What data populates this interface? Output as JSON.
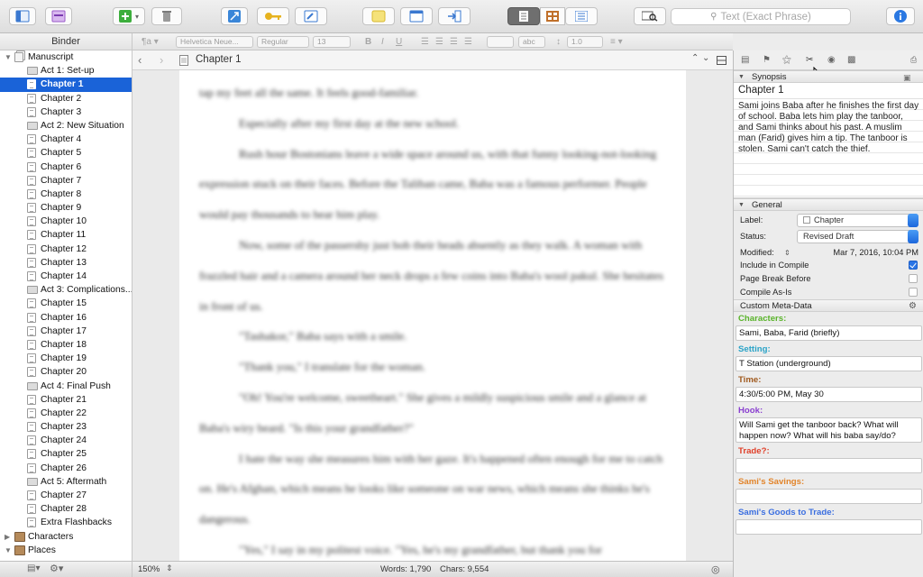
{
  "toolbar": {
    "search_placeholder": "Text (Exact Phrase)",
    "icons": [
      "binder-toggle-icon",
      "collections-icon",
      "add-icon",
      "trash-icon",
      "fullscreen-icon",
      "keywords-icon",
      "edit-scrivening-icon",
      "notes-icon",
      "layout-icon",
      "compile-icon",
      "editor-view-icon",
      "corkboard-icon",
      "outliner-icon",
      "quick-search-icon",
      "inspector-toggle-icon"
    ]
  },
  "binder": {
    "header": "Binder",
    "items": [
      {
        "label": "Manuscript",
        "level": 0,
        "type": "stack",
        "expanded": true
      },
      {
        "label": "Act 1: Set-up",
        "level": 1,
        "type": "folder"
      },
      {
        "label": "Chapter 1",
        "level": 1,
        "type": "doc",
        "selected": true
      },
      {
        "label": "Chapter 2",
        "level": 1,
        "type": "doc"
      },
      {
        "label": "Chapter 3",
        "level": 1,
        "type": "doc"
      },
      {
        "label": "Act 2: New Situation",
        "level": 1,
        "type": "folder"
      },
      {
        "label": "Chapter 4",
        "level": 1,
        "type": "doc"
      },
      {
        "label": "Chapter 5",
        "level": 1,
        "type": "doc"
      },
      {
        "label": "Chapter 6",
        "level": 1,
        "type": "doc"
      },
      {
        "label": "Chapter 7",
        "level": 1,
        "type": "doc"
      },
      {
        "label": "Chapter 8",
        "level": 1,
        "type": "doc"
      },
      {
        "label": "Chapter 9",
        "level": 1,
        "type": "doc"
      },
      {
        "label": "Chapter 10",
        "level": 1,
        "type": "doc"
      },
      {
        "label": "Chapter 11",
        "level": 1,
        "type": "doc"
      },
      {
        "label": "Chapter 12",
        "level": 1,
        "type": "doc"
      },
      {
        "label": "Chapter 13",
        "level": 1,
        "type": "doc"
      },
      {
        "label": "Chapter 14",
        "level": 1,
        "type": "doc"
      },
      {
        "label": "Act 3: Complications...",
        "level": 1,
        "type": "folder"
      },
      {
        "label": "Chapter 15",
        "level": 1,
        "type": "doc"
      },
      {
        "label": "Chapter 16",
        "level": 1,
        "type": "doc"
      },
      {
        "label": "Chapter 17",
        "level": 1,
        "type": "doc"
      },
      {
        "label": "Chapter 18",
        "level": 1,
        "type": "doc"
      },
      {
        "label": "Chapter 19",
        "level": 1,
        "type": "doc"
      },
      {
        "label": "Chapter 20",
        "level": 1,
        "type": "doc"
      },
      {
        "label": "Act 4: Final Push",
        "level": 1,
        "type": "folder"
      },
      {
        "label": "Chapter 21",
        "level": 1,
        "type": "doc"
      },
      {
        "label": "Chapter 22",
        "level": 1,
        "type": "doc"
      },
      {
        "label": "Chapter 23",
        "level": 1,
        "type": "doc"
      },
      {
        "label": "Chapter 24",
        "level": 1,
        "type": "doc"
      },
      {
        "label": "Chapter 25",
        "level": 1,
        "type": "doc"
      },
      {
        "label": "Chapter 26",
        "level": 1,
        "type": "doc"
      },
      {
        "label": "Act 5: Aftermath",
        "level": 1,
        "type": "folder"
      },
      {
        "label": "Chapter 27",
        "level": 1,
        "type": "doc"
      },
      {
        "label": "Chapter 28",
        "level": 1,
        "type": "doc"
      },
      {
        "label": "Extra Flashbacks",
        "level": 1,
        "type": "doc"
      },
      {
        "label": "Characters",
        "level": 0,
        "type": "pic",
        "expanded": false
      },
      {
        "label": "Places",
        "level": 0,
        "type": "pic",
        "expanded": true
      }
    ]
  },
  "formatbar": {
    "font": "Helvetica Neue...",
    "style": "Regular",
    "size": "13",
    "text_color": "abc",
    "line_spacing": "1.0"
  },
  "editor": {
    "title": "Chapter 1",
    "paragraphs": [
      {
        "text": "tap my feet all the same. It feels good-familiar.",
        "indent": false
      },
      {
        "text": "Especially after my first day at the new school.",
        "indent": true
      },
      {
        "text": "Rush hour Bostonians leave a wide space around us, with that funny looking-not-looking expression stuck on their faces. Before the Taliban came, Baba was a famous performer. People would pay thousands to hear him play.",
        "indent": true
      },
      {
        "text": "Now, some of the passersby just bob their heads absently as they walk. A woman with frazzled hair and a camera around her neck drops a few coins into Baba's wool pakul. She hesitates in front of us.",
        "indent": true
      },
      {
        "text": "\"Tashakor,\" Baba says with a smile.",
        "indent": true
      },
      {
        "text": "\"Thank you,\" I translate for the woman.",
        "indent": true
      },
      {
        "text": "\"Oh! You're welcome, sweetheart.\" She gives a mildly suspicious smile and a glance at Baba's wiry beard. \"Is this your grandfather?\"",
        "indent": true
      },
      {
        "text": "I hate the way she measures him with her gaze. It's happened often enough for me to catch on. He's Afghan, which means he looks like someone on war news, which means she thinks he's dangerous.",
        "indent": true
      },
      {
        "text": "\"Yes,\" I say in my politest voice. \"Yes, he's my grandfather, but thank you for",
        "indent": true
      }
    ]
  },
  "status": {
    "zoom": "150%",
    "words": "Words: 1,790",
    "chars": "Chars: 9,554"
  },
  "inspector": {
    "synopsis_header": "Synopsis",
    "synopsis_title": "Chapter 1",
    "synopsis_text": "Sami joins Baba after he finishes the first day of school. Baba lets him play the tanboor, and Sami thinks about his past. A muslim man (Farid) gives him a tip. The tanboor is stolen. Sami can't catch the thief.",
    "general_header": "General",
    "label_key": "Label:",
    "label_value": "Chapter",
    "status_key": "Status:",
    "status_value": "Revised Draft",
    "modified_key": "Modified:",
    "modified_value": "Mar 7, 2016, 10:04 PM",
    "include_compile": "Include in Compile",
    "include_compile_checked": true,
    "page_break": "Page Break Before",
    "page_break_checked": false,
    "compile_as_is": "Compile As-Is",
    "compile_as_is_checked": false,
    "meta_header": "Custom Meta-Data",
    "meta": [
      {
        "key": "Characters:",
        "value": "Sami, Baba, Farid (briefly)",
        "color": "#59b32a"
      },
      {
        "key": "Setting:",
        "value": "T Station (underground)",
        "color": "#2aa3c7"
      },
      {
        "key": "Time:",
        "value": "4:30/5:00 PM, May 30",
        "color": "#a05a1e"
      },
      {
        "key": "Hook:",
        "value": "Will Sami get the tanboor back? What will happen now? What will his baba say/do?",
        "color": "#8a3fd0"
      },
      {
        "key": "Trade?:",
        "value": "",
        "color": "#e0402a"
      },
      {
        "key": "Sami's Savings:",
        "value": "",
        "color": "#e2842a"
      },
      {
        "key": "Sami's Goods to Trade:",
        "value": "",
        "color": "#3a6ee0"
      }
    ]
  }
}
